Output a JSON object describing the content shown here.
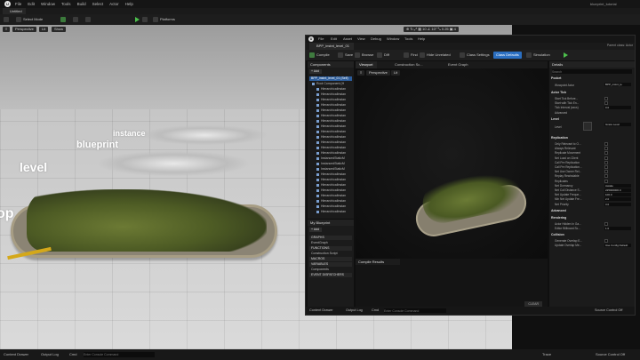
{
  "main": {
    "menu": [
      "File",
      "Edit",
      "Window",
      "Tools",
      "Build",
      "Select",
      "Actor",
      "Help"
    ],
    "project": "blueprint_tutorial",
    "level_tab": "Untitled",
    "toolbar": {
      "select_mode": "Select Mode",
      "platforms": "Platforms"
    },
    "viewport": {
      "perspective": "Perspective",
      "lit": "Lit",
      "show": "Show"
    },
    "words": {
      "instance": "instance",
      "blueprint": "blueprint",
      "level": "level",
      "partial": "op"
    }
  },
  "bottom": {
    "content_drawer": "Content Drawer",
    "output_log": "Output Log",
    "cmd": "Cmd",
    "cmd_placeholder": "Enter Console Command",
    "trace": "Trace",
    "source_control": "Source Control Off"
  },
  "bp": {
    "menu": [
      "File",
      "Edit",
      "Asset",
      "View",
      "Debug",
      "Window",
      "Tools",
      "Help"
    ],
    "tab": "BPP_instnt_level_01",
    "parent_class": "Parent class: Actor",
    "toolbar": {
      "compile": "Compile",
      "save": "Save",
      "browse": "Browse",
      "diff": "Diff",
      "find": "Find",
      "hide_unrelated": "Hide Unrelated",
      "class_settings": "Class Settings",
      "class_defaults": "Class Defaults",
      "simulation": "Simulation"
    },
    "components": {
      "title": "Components",
      "add": "+ Add",
      "self": "BPP_instnt_level_01 (Self)",
      "root": "Root Component (H",
      "items": [
        "HierarchicalInstan",
        "HierarchicalInstan",
        "HierarchicalInstan",
        "HierarchicalInstan",
        "HierarchicalInstan",
        "HierarchicalInstan",
        "HierarchicalInstan",
        "HierarchicalInstan",
        "HierarchicalInstan",
        "HierarchicalInstan",
        "HierarchicalInstan",
        "HierarchicalInstan",
        "HierarchicalInstan",
        "InstancedStaticM",
        "InstancedStaticM",
        "InstancedStaticM",
        "HierarchicalInstan",
        "HierarchicalInstan",
        "HierarchicalInstan",
        "HierarchicalInstan",
        "HierarchicalInstan",
        "HierarchicalInstan",
        "HierarchicalInstan",
        "HierarchicalInstan"
      ]
    },
    "my_blueprint": {
      "title": "My Blueprint",
      "add": "+ Add",
      "sections": [
        "GRAPHS",
        "EventGraph",
        "FUNCTIONS",
        "Construction Script",
        "MACROS",
        "VARIABLES",
        "Components",
        "EVENT DISPATCHERS"
      ]
    },
    "tabs": [
      "Viewport",
      "Construction Sc...",
      "Event Graph"
    ],
    "vp_buttons": {
      "perspective": "Perspective",
      "lit": "Lit"
    },
    "compile_results": "Compile Results",
    "clear": "CLEAR",
    "details": {
      "title": "Details",
      "search_placeholder": "Search",
      "sections": [
        {
          "name": "Pocket",
          "rows": [
            "Wowpoint Actor"
          ],
          "value": "BPP_instnt_le"
        },
        {
          "name": "Actor Tick",
          "rows": [
            "Start Tick Before...",
            "Start with Tick En...",
            "Tick Interval (secs)",
            "Advanced"
          ],
          "value": "0.0"
        },
        {
          "name": "Level",
          "rows": [
            "Level"
          ],
          "value": "Grass Level"
        },
        {
          "name": "Replication",
          "rows": [
            "Only Relevant to O...",
            "Always Relevant",
            "Replicate Movement",
            "Net Load on Client",
            "Call Pre Replication",
            "Call Pre Replication...",
            "Net Use Owner Rel...",
            "Replay Rewindable",
            "Replicates",
            "Net Dormancy",
            "Net Cull Distance S...",
            "Net Update Freque...",
            "Min Net Update Fre...",
            "Net Priority"
          ],
          "values": [
            "Awake",
            "225000000.0",
            "100.0",
            "2.0",
            "3.0"
          ]
        },
        {
          "name": "Advanced",
          "rows": []
        },
        {
          "name": "Rendering",
          "rows": [
            "Actor Hidden In Ga...",
            "Editor Billboard Sc..."
          ],
          "value": "1.0"
        },
        {
          "name": "Collision",
          "rows": [
            "Generate Overlap E...",
            "Update Overlap Me..."
          ],
          "value": "Use Config Default"
        }
      ]
    },
    "bottom": {
      "content_drawer": "Content Drawer",
      "output_log": "Output Log",
      "cmd": "Cmd",
      "cmd_placeholder": "Enter Console Command",
      "source_control": "Source Control Off"
    }
  }
}
